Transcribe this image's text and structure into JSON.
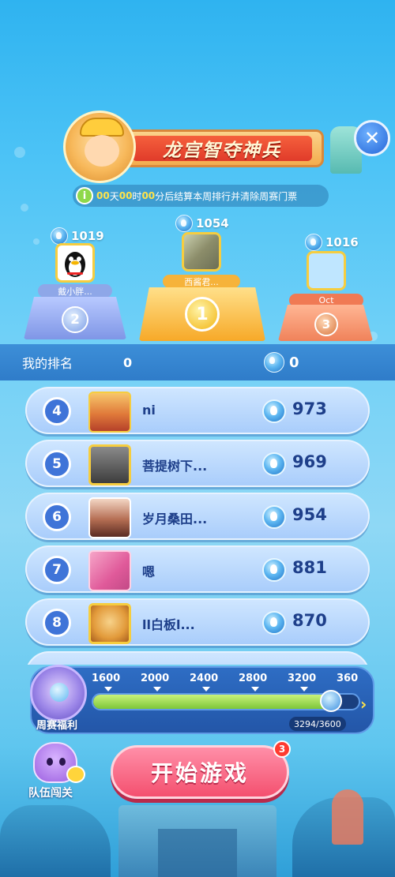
{
  "header": {
    "title": "龙宫智夺神兵",
    "countdown": {
      "days": "00",
      "days_unit": "天",
      "hours": "00",
      "hours_unit": "时",
      "minutes": "00",
      "tail": "分后结算本周排行并清除周赛门票"
    }
  },
  "podium": {
    "second": {
      "rank": "2",
      "score": "1019",
      "name": "戴小胖..."
    },
    "first": {
      "rank": "1",
      "score": "1054",
      "name": "西酱君..."
    },
    "third": {
      "rank": "3",
      "score": "1016",
      "name": "Oct"
    }
  },
  "my_rank": {
    "label": "我的排名",
    "rank": "0",
    "score": "0"
  },
  "ranking": [
    {
      "rank": "4",
      "name": "ni",
      "score": "973"
    },
    {
      "rank": "5",
      "name": "菩提树下...",
      "score": "969"
    },
    {
      "rank": "6",
      "name": "岁月桑田...",
      "score": "954"
    },
    {
      "rank": "7",
      "name": "嗯",
      "score": "881"
    },
    {
      "rank": "8",
      "name": "ll白板l...",
      "score": "870"
    }
  ],
  "weekly_reward": {
    "label": "周赛福利",
    "ticks": [
      "1600",
      "2000",
      "2400",
      "2800",
      "3200",
      "360"
    ],
    "progress_text": "3294/3600",
    "progress_fraction": 0.89
  },
  "actions": {
    "start_label": "开始游戏",
    "start_badge": "3",
    "team_label": "队伍闯关"
  },
  "colors": {
    "accent_blue": "#3f74d8",
    "gold": "#f6cd3f",
    "start_pink": "#f4506f"
  }
}
